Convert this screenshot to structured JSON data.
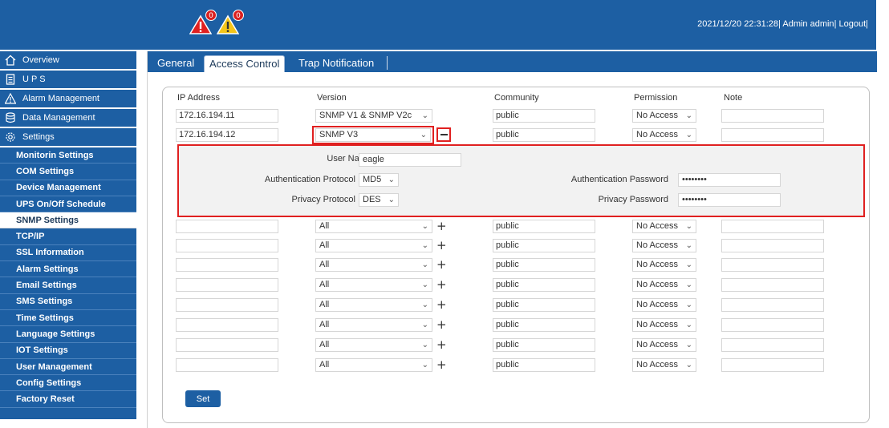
{
  "header": {
    "alarm_critical_count": "0",
    "alarm_warning_count": "0",
    "datetime": "2021/12/20 22:31:28",
    "user_label": "Admin admin",
    "logout_label": "Logout",
    "sep1": "|",
    "sep2": "|",
    "sep3": "|"
  },
  "sidebar": {
    "main_items": [
      {
        "label": "Overview",
        "icon": "home-icon"
      },
      {
        "label": "U P S",
        "icon": "ups-icon"
      },
      {
        "label": "Alarm Management",
        "icon": "warning-icon"
      },
      {
        "label": "Data Management",
        "icon": "database-icon"
      },
      {
        "label": "Settings",
        "icon": "gear-icon"
      }
    ],
    "sub_items": [
      "Monitorin Settings",
      "COM Settings",
      "Device Management",
      "UPS On/Off Schedule",
      "SNMP Settings",
      "TCP/IP",
      "SSL Information",
      "Alarm Settings",
      "Email Settings",
      "SMS Settings",
      "Time Settings",
      "Language Settings",
      "IOT Settings",
      "User Management",
      "Config Settings",
      "Factory Reset"
    ],
    "active_sub": "SNMP Settings"
  },
  "tabs": [
    {
      "label": "General"
    },
    {
      "label": "Access Control"
    },
    {
      "label": "Trap Notification"
    }
  ],
  "table": {
    "headers": {
      "ip": "IP Address",
      "version": "Version",
      "community": "Community",
      "permission": "Permission",
      "note": "Note"
    },
    "rows": [
      {
        "ip": "172.16.194.11",
        "version": "SNMP V1 & SNMP V2c",
        "community": "public",
        "permission": "No Access"
      },
      {
        "ip": "172.16.194.12",
        "version": "SNMP V3",
        "community": "public",
        "permission": "No Access"
      },
      {
        "ip": "",
        "version": "All",
        "community": "public",
        "permission": "No Access"
      },
      {
        "ip": "",
        "version": "All",
        "community": "public",
        "permission": "No Access"
      },
      {
        "ip": "",
        "version": "All",
        "community": "public",
        "permission": "No Access"
      },
      {
        "ip": "",
        "version": "All",
        "community": "public",
        "permission": "No Access"
      },
      {
        "ip": "",
        "version": "All",
        "community": "public",
        "permission": "No Access"
      },
      {
        "ip": "",
        "version": "All",
        "community": "public",
        "permission": "No Access"
      },
      {
        "ip": "",
        "version": "All",
        "community": "public",
        "permission": "No Access"
      },
      {
        "ip": "",
        "version": "All",
        "community": "public",
        "permission": "No Access"
      }
    ]
  },
  "snmpv3": {
    "user_name_label": "User Name",
    "user_name": "eagle",
    "auth_protocol_label": "Authentication Protocol",
    "auth_protocol": "MD5",
    "privacy_protocol_label": "Privacy Protocol",
    "privacy_protocol": "DES",
    "auth_password_label": "Authentication Password",
    "auth_password": "••••••••",
    "privacy_password_label": "Privacy Password",
    "privacy_password": "••••••••"
  },
  "actions": {
    "set_label": "Set"
  },
  "colors": {
    "brand_blue": "#1d5fa3",
    "highlight_red": "#e02020"
  }
}
